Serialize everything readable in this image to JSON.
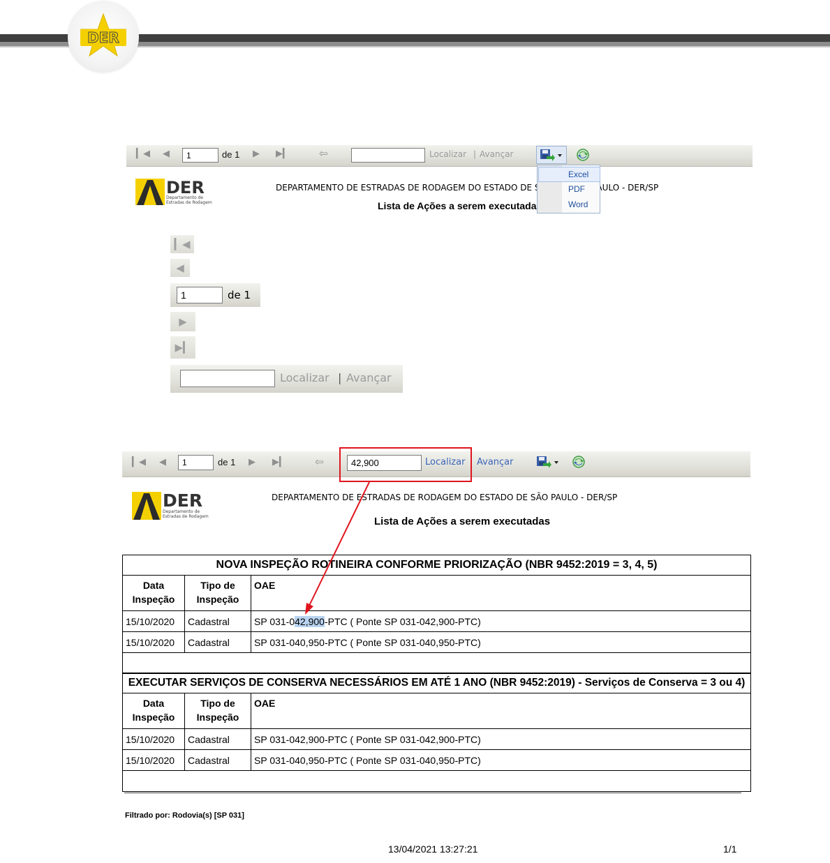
{
  "header": {
    "logo_text": "DER"
  },
  "toolbar1": {
    "page_value": "1",
    "of_label": "de 1",
    "search_value": "",
    "find_label": "Localizar",
    "separator": "|",
    "next_label": "Avançar",
    "export_menu": [
      "Excel",
      "PDF",
      "Word"
    ]
  },
  "report1": {
    "logo_big": "DER",
    "logo_sub1": "Departamento de",
    "logo_sub2": "Estradas de Rodagem",
    "department": "DEPARTAMENTO DE ESTRADAS DE RODAGEM DO ESTADO DE SÃO PAULO - DER/SP",
    "list_title": "Lista de Ações a serem executadas"
  },
  "vertical_toolbar": {
    "page_value": "1",
    "of_label": "de 1",
    "search_value": "",
    "find_label": "Localizar",
    "separator": "|",
    "next_label": "Avançar"
  },
  "toolbar2": {
    "page_value": "1",
    "of_label": "de 1",
    "search_value": "42,900",
    "find_label": "Localizar",
    "next_label": "Avançar"
  },
  "report2": {
    "logo_big": "DER",
    "logo_sub1": "Departamento de",
    "logo_sub2": "Estradas de Rodagem",
    "department": "DEPARTAMENTO DE ESTRADAS DE RODAGEM DO ESTADO DE SÃO PAULO - DER/SP",
    "list_title": "Lista de Ações a serem executadas"
  },
  "columns": {
    "date_line1": "Data",
    "date_line2": "Inspeção",
    "type_line1": "Tipo de",
    "type_line2": "Inspeção",
    "oae": "OAE"
  },
  "table1": {
    "title": "NOVA INSPEÇÃO ROTINEIRA CONFORME PRIORIZAÇÃO (NBR 9452:2019 = 3, 4, 5)",
    "rows": [
      {
        "date": "15/10/2020",
        "type": "Cadastral",
        "oae_pre": "SP 031-0",
        "oae_hl": "42,900",
        "oae_post": "-PTC ( Ponte SP 031-042,900-PTC)"
      },
      {
        "date": "15/10/2020",
        "type": "Cadastral",
        "oae": "SP 031-040,950-PTC ( Ponte SP 031-040,950-PTC)"
      }
    ]
  },
  "table2": {
    "title": "EXECUTAR SERVIÇOS DE CONSERVA NECESSÁRIOS EM ATÉ 1 ANO (NBR 9452:2019) - Serviços de Conserva = 3 ou 4)",
    "rows": [
      {
        "date": "15/10/2020",
        "type": "Cadastral",
        "oae": "SP 031-042,900-PTC ( Ponte SP 031-042,900-PTC)"
      },
      {
        "date": "15/10/2020",
        "type": "Cadastral",
        "oae": "SP 031-040,950-PTC ( Ponte SP 031-040,950-PTC)"
      }
    ]
  },
  "footer": {
    "filter": "Filtrado por: Rodovia(s) [SP 031]",
    "timestamp": "13/04/2021 13:27:21",
    "page": "1/1"
  },
  "colors": {
    "accent_red": "#e0141e",
    "link_blue": "#3a64b7",
    "logo_yellow": "#f5d000"
  }
}
